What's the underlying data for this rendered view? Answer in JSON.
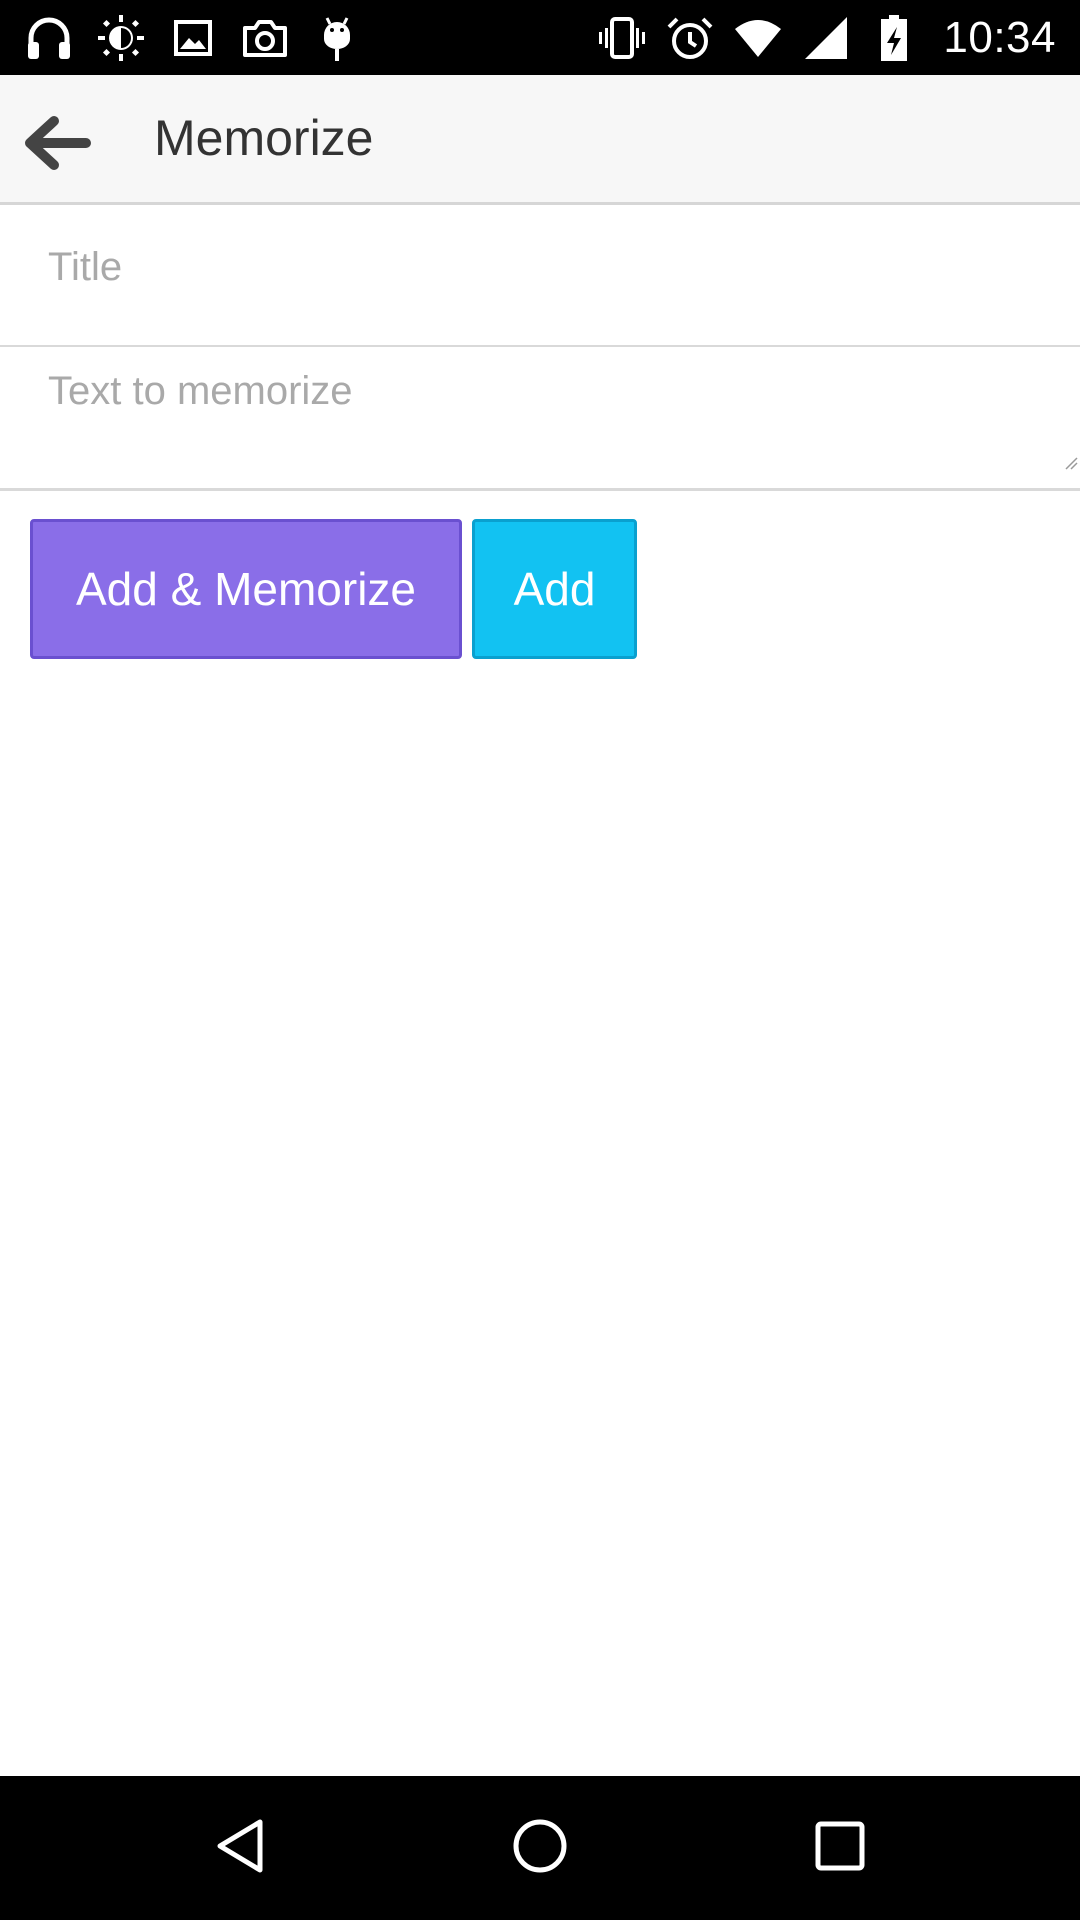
{
  "status_bar": {
    "time": "10:34",
    "left_icons": [
      "headphones-icon",
      "brightness-icon",
      "image-icon",
      "camera-icon",
      "android-debug-icon"
    ],
    "right_icons": [
      "vibrate-icon",
      "alarm-icon",
      "wifi-icon",
      "cellular-signal-icon",
      "battery-charging-icon"
    ]
  },
  "app_bar": {
    "title": "Memorize",
    "back_icon": "arrow-left-icon"
  },
  "form": {
    "title_placeholder": "Title",
    "title_value": "",
    "text_placeholder": "Text to memorize",
    "text_value": ""
  },
  "buttons": {
    "add_memorize": "Add & Memorize",
    "add": "Add"
  },
  "colors": {
    "add_memorize_bg": "#8a6ee8",
    "add_bg": "#12c2f2",
    "app_bar_bg": "#f7f7f7",
    "system_bars_bg": "#000000"
  },
  "nav_bar": {
    "icons": [
      "nav-back-icon",
      "nav-home-icon",
      "nav-recents-icon"
    ]
  }
}
